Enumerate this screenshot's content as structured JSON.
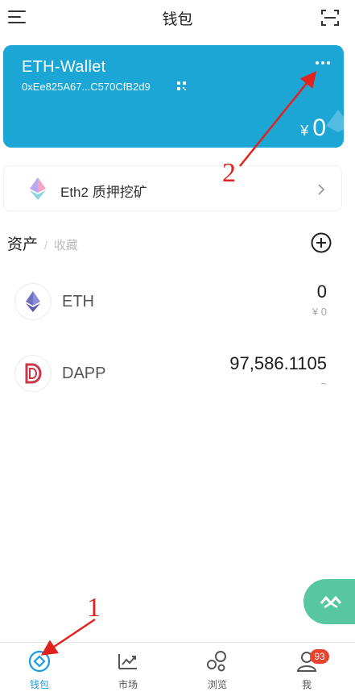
{
  "header": {
    "title": "钱包"
  },
  "wallet": {
    "name": "ETH-Wallet",
    "address": "0xEe825A67...C570CfB2d9",
    "currency_symbol": "¥",
    "balance": "0",
    "card_color": "#1ba6d6"
  },
  "staking": {
    "label": "Eth2 质押挖矿"
  },
  "assets": {
    "tab_active": "资产",
    "separator": "/",
    "tab_inactive": "收藏",
    "items": [
      {
        "symbol": "ETH",
        "amount": "0",
        "fiat": "¥ 0",
        "icon": "eth-logo-icon"
      },
      {
        "symbol": "DAPP",
        "amount": "97,586.1105",
        "fiat": "~",
        "icon": "dapp-logo-icon"
      }
    ]
  },
  "nav": {
    "items": [
      {
        "label": "钱包",
        "icon": "wallet-diamond-icon",
        "active": true
      },
      {
        "label": "市场",
        "icon": "market-chart-icon"
      },
      {
        "label": "浏览",
        "icon": "browse-bubbles-icon"
      },
      {
        "label": "我",
        "icon": "profile-icon",
        "badge": "93"
      }
    ]
  },
  "annotations": {
    "one": "1",
    "two": "2"
  },
  "colors": {
    "accent": "#1b9be0",
    "float_button": "#57c7a2",
    "badge": "#e8412c",
    "annotation": "#e0231c"
  }
}
